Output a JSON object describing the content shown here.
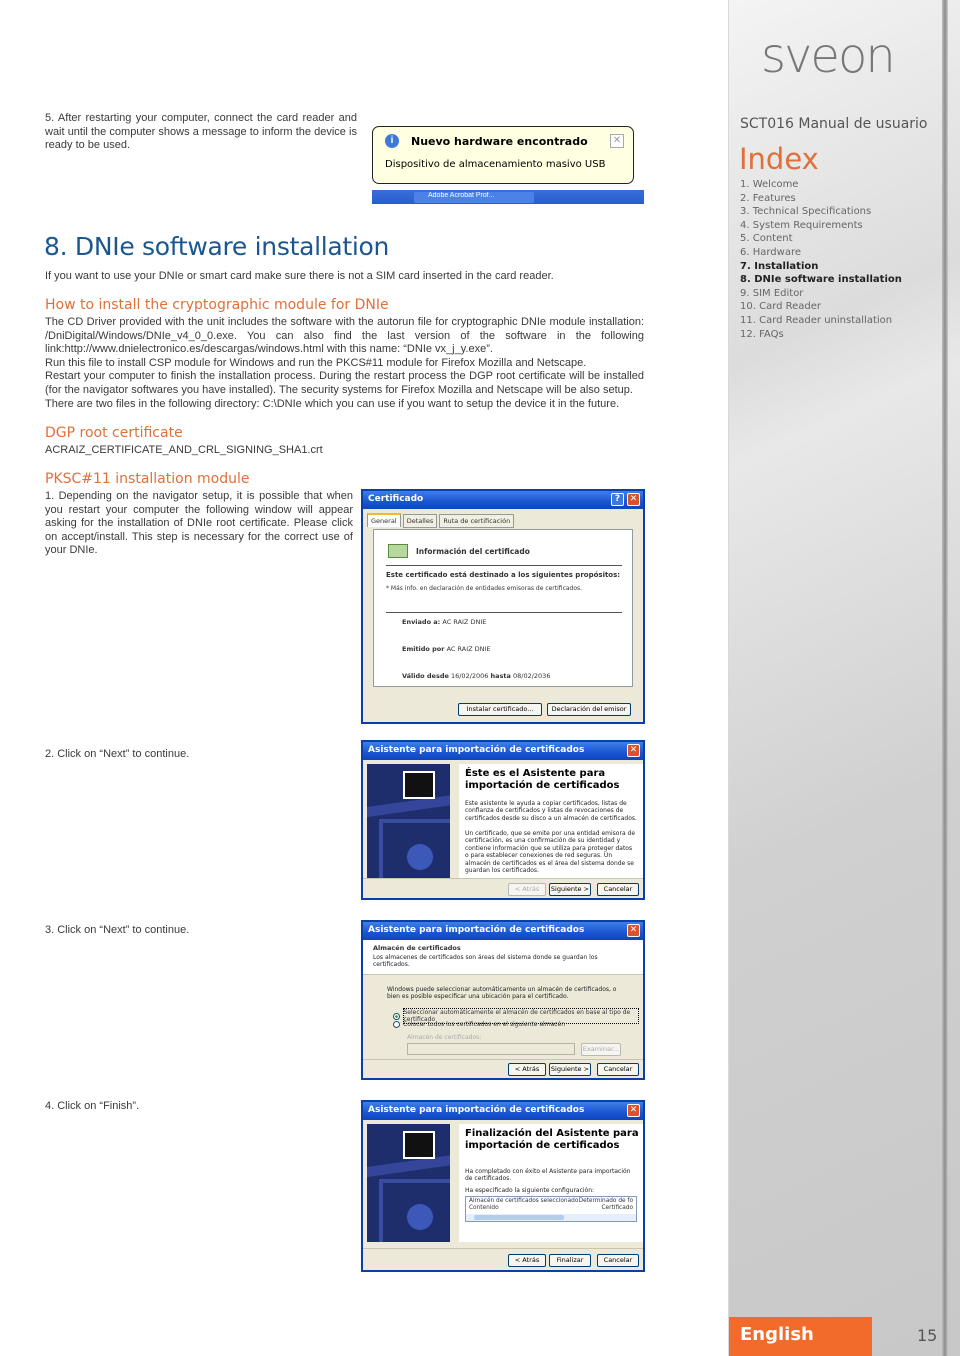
{
  "sidebar": {
    "logo": "sveon",
    "manual_title": "SCT016 Manual de usuario",
    "index_title": "Index",
    "index_items": [
      {
        "label": "1. Welcome",
        "active": false
      },
      {
        "label": "2. Features",
        "active": false
      },
      {
        "label": "3. Technical Specifications",
        "active": false
      },
      {
        "label": "4. System Requirements",
        "active": false
      },
      {
        "label": "5. Content",
        "active": false
      },
      {
        "label": "6. Hardware",
        "active": false
      },
      {
        "label": "7. Installation",
        "active": true
      },
      {
        "label": "8. DNIe software installation",
        "active": true
      },
      {
        "label": "9. SIM Editor",
        "active": false
      },
      {
        "label": "10. Card Reader",
        "active": false
      },
      {
        "label": "11. Card Reader uninstallation",
        "active": false
      },
      {
        "label": "12. FAQs",
        "active": false
      }
    ],
    "language": "English",
    "page_number": "15"
  },
  "step5": {
    "text": "5. After restarting your computer, connect the card reader and wait until the computer shows a message to inform the device is ready to be used."
  },
  "balloon": {
    "title": "Nuevo hardware encontrado",
    "message": "Dispositivo de almacenamiento masivo USB",
    "taskbar_item": "Adobe Acrobat Prof..."
  },
  "section": {
    "title": "8. DNIe software installation",
    "intro": "If you want to use your DNIe or smart card make sure there is not a SIM card inserted in the card reader.",
    "crypto_heading": "How to install the cryptographic module for DNIe",
    "crypto_p1": "The CD Driver provided with the unit includes the software with the autorun file for cryptographic DNIe module installation: /DniDigital/Windows/DNIe_v4_0_0.exe. You can also find the last version of the software in the following link:http://www.dnielectronico.es/descargas/windows.html with this name: “DNIe vx_j_y.exe”.",
    "crypto_p2": "Run this file to install CSP module for Windows and run the PKCS#11 module for Firefox Mozilla and Netscape.",
    "crypto_p3": "Restart your computer to finish the installation process. During the restart process the DGP root certificate will be installed (for the navigator softwares you have installed). The security systems for Firefox Mozilla and Netscape will be also setup.",
    "crypto_p4": "There are two files in the following directory: C:\\DNIe which you can use if you want to setup the device it in the future.",
    "dgp_heading": "DGP root certificate",
    "dgp_file": "ACRAIZ_CERTIFICATE_AND_CRL_SIGNING_SHA1.crt",
    "pksc_heading": "PKSC#11 installation module",
    "step1": "1.  Depending on the navigator setup, it is possible that when you restart your computer the following window will appear asking for the installation of DNIe root certificate. Please click on accept/install. This step is necessary for the correct use of your DNIe.",
    "step2": "2. Click on “Next” to continue.",
    "step3": "3. Click on “Next” to continue.",
    "step4": "4. Click on “Finish”."
  },
  "cert_dialog": {
    "title": "Certificado",
    "tabs": [
      "General",
      "Detalles",
      "Ruta de certificación"
    ],
    "info_heading": "Información del certificado",
    "purpose_heading": "Este certificado está destinado a los siguientes propósitos:",
    "purpose_note": "* Más info. en declaración de entidades emisoras de certificados.",
    "issued_to_label": "Enviado a:",
    "issued_to": "AC RAIZ DNIE",
    "issued_by_label": "Emitido por",
    "issued_by": "AC RAIZ DNIE",
    "valid_from_label": "Válido desde",
    "valid_from": "16/02/2006",
    "valid_to_label": "hasta",
    "valid_to": "08/02/2036",
    "install_button": "Instalar certificado...",
    "statement_button": "Declaración del emisor"
  },
  "wizard1": {
    "title": "Asistente para importación de certificados",
    "heading": "Éste es el Asistente para importación de certificados",
    "p1": "Este asistente le ayuda a copiar certificados, listas de confianza de certificados y listas de revocaciones de certificados desde su disco a un almacén de certificados.",
    "p2": "Un certificado, que se emite por una entidad emisora de certificación, es una confirmación de su identidad y contiene información que se utiliza para proteger datos o para establecer conexiones de red seguras. Un almacén de certificados es el área del sistema donde se guardan los certificados.",
    "back": "< Atrás",
    "next": "Siguiente >",
    "cancel": "Cancelar"
  },
  "wizard2": {
    "title": "Asistente para importación de certificados",
    "heading": "Almacén de certificados",
    "subheading": "Los almacenes de certificados son áreas del sistema donde se guardan los certificados.",
    "p1": "Windows puede seleccionar automáticamente un almacén de certificados, o bien es posible especificar una ubicación para el certificado.",
    "option_auto": "Seleccionar automáticamente el almacén de certificados en base al tipo de certificado",
    "option_manual": "Colocar todos los certificados en el siguiente almacén",
    "store_label": "Almacén de certificados:",
    "store_value": "",
    "browse": "Examinar...",
    "back": "< Atrás",
    "next": "Siguiente >",
    "cancel": "Cancelar"
  },
  "wizard3": {
    "title": "Asistente para importación de certificados",
    "heading": "Finalización del Asistente para importación de certificados",
    "p1": "Ha completado con éxito el Asistente para importación de certificados.",
    "p2": "Ha especificado la siguiente configuración:",
    "rows": [
      {
        "key": "Almacén de certificados seleccionado",
        "value": "Determinado de fo"
      },
      {
        "key": "Contenido",
        "value": "Certificado"
      }
    ],
    "back": "< Atrás",
    "finish": "Finalizar",
    "cancel": "Cancelar"
  }
}
